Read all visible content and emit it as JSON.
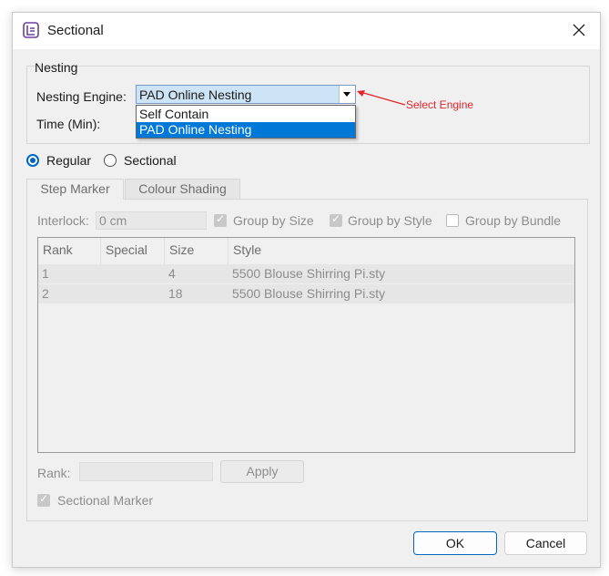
{
  "window": {
    "title": "Sectional",
    "app_icon": "sectional-app-icon",
    "close_icon": "close-icon"
  },
  "nesting": {
    "group_title": "Nesting",
    "engine_label": "Nesting Engine:",
    "engine_value": "PAD Online Nesting",
    "time_label": "Time (Min):",
    "options": [
      "Self Contain",
      "PAD Online Nesting"
    ],
    "selected_option": "PAD Online Nesting"
  },
  "annotation": {
    "text": "Select Engine",
    "color": "#e0262e"
  },
  "mode": {
    "regular_label": "Regular",
    "sectional_label": "Sectional",
    "selected": "Regular"
  },
  "tabs": [
    {
      "label": "Step Marker",
      "active": true
    },
    {
      "label": "Colour Shading",
      "active": false
    }
  ],
  "step_marker": {
    "interlock_label": "Interlock:",
    "interlock_value": "0 cm",
    "group_by_size": "Group by Size",
    "group_by_style": "Group by Style",
    "group_by_bundle": "Group by Bundle",
    "group_by_size_checked": true,
    "group_by_style_checked": true,
    "group_by_bundle_checked": false,
    "columns": [
      "Rank",
      "Special",
      "Size",
      "Style"
    ],
    "rows": [
      {
        "rank": "1",
        "special": "",
        "size": "4",
        "style": "5500 Blouse Shirring Pi.sty"
      },
      {
        "rank": "2",
        "special": "",
        "size": "18",
        "style": "5500 Blouse Shirring Pi.sty"
      }
    ],
    "rank_label": "Rank:",
    "rank_value": "",
    "apply_label": "Apply",
    "sectional_marker_label": "Sectional Marker",
    "sectional_marker_checked": true
  },
  "buttons": {
    "ok": "OK",
    "cancel": "Cancel"
  },
  "colors": {
    "accent": "#0067c0",
    "selection": "#0078d7",
    "combo_highlight": "#cde4f7"
  }
}
